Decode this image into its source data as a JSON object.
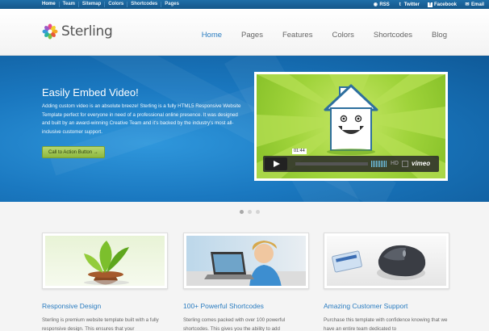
{
  "topbar": {
    "nav": [
      "Home",
      "Team",
      "Sitemap",
      "Colors",
      "Shortcodes",
      "Pages"
    ],
    "social": [
      {
        "icon": "rss-icon",
        "label": "RSS"
      },
      {
        "icon": "twitter-icon",
        "label": "Twitter"
      },
      {
        "icon": "facebook-icon",
        "label": "Facebook"
      },
      {
        "icon": "email-icon",
        "label": "Email"
      }
    ]
  },
  "header": {
    "logo_text": "Sterling",
    "nav": [
      "Home",
      "Pages",
      "Features",
      "Colors",
      "Shortcodes",
      "Blog"
    ],
    "active": "Home"
  },
  "hero": {
    "title": "Easily Embed Video!",
    "body": "Adding custom video is an absolute breeze! Sterling is a fully HTML5 Responsive Website Template perfect for everyone in need of a professional online presence. It was designed and built by an award-winning Creative Team and it's backed by the industry's most all-inclusive customer support.",
    "cta": "Call to Action Button →",
    "video": {
      "time": "01:44",
      "hd": "HD",
      "brand": "vimeo"
    }
  },
  "slider": {
    "count": 3,
    "active_index": 0
  },
  "features": [
    {
      "title": "Responsive Design",
      "text": "Sterling is premium website template built with a fully responsive design. This ensures that your"
    },
    {
      "title": "100+ Powerful Shortcodes",
      "text": "Sterling comes packed with over 100 powerful shortcodes. This gives you the ability to add"
    },
    {
      "title": "Amazing Customer Support",
      "text": "Purchase this template with confidence knowing that we have an entire team dedicated to"
    }
  ],
  "colors": {
    "accent": "#2a7cc0",
    "topbar": "#1a63a0",
    "hero": "#1a78c0",
    "cta": "#a3c854"
  }
}
